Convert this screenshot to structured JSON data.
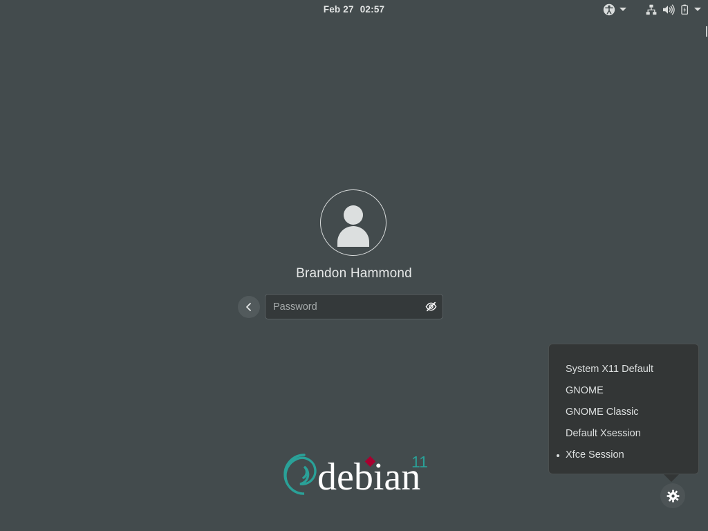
{
  "topbar": {
    "clock": {
      "date": "Feb 27",
      "time": "02:57",
      "full": "Feb 27  02:57"
    },
    "tray": {
      "accessibility_icon": "accessibility-icon",
      "accessibility_chevron": "chevron-down-icon",
      "network_icon": "wired-network-icon",
      "volume_icon": "volume-high-icon",
      "battery_icon": "battery-charging-icon",
      "system_chevron": "chevron-down-icon"
    }
  },
  "auth": {
    "avatar_icon": "default-user-avatar-icon",
    "username": "Brandon Hammond",
    "back_button_icon": "chevron-left-icon",
    "password": {
      "value": "",
      "placeholder": "Password",
      "reveal_icon": "eye-slash-icon"
    }
  },
  "branding": {
    "logo_text": "debian",
    "version": "11",
    "swirl_color": "#2aa198",
    "text_color": "#ffffff",
    "dot_color": "#a80030",
    "version_color": "#2aa198"
  },
  "session_menu": {
    "visible": true,
    "items": [
      {
        "label": "System X11 Default",
        "selected": false
      },
      {
        "label": "GNOME",
        "selected": false
      },
      {
        "label": "GNOME Classic",
        "selected": false
      },
      {
        "label": "Default Xsession",
        "selected": false
      },
      {
        "label": "Xfce Session",
        "selected": true
      }
    ]
  },
  "session_button": {
    "icon": "gear-icon",
    "label": "Session settings"
  },
  "colors": {
    "background": "#434b4d",
    "menu_background": "#333636",
    "field_background": "#34393a",
    "text": "#e6e8e8",
    "muted_text": "#a6abab"
  }
}
